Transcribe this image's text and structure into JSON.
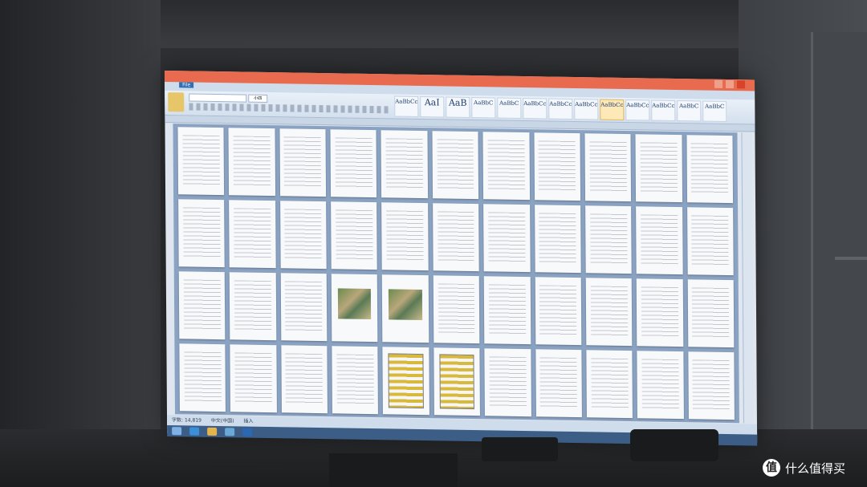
{
  "word": {
    "file_tab": "File",
    "font_size": "小四",
    "styles": [
      {
        "sample": "AaBbCc",
        "name": ""
      },
      {
        "sample": "AaI",
        "name": ""
      },
      {
        "sample": "AaB",
        "name": ""
      },
      {
        "sample": "AaBbC",
        "name": ""
      },
      {
        "sample": "AaBbC",
        "name": ""
      },
      {
        "sample": "AaBbCc",
        "name": ""
      },
      {
        "sample": "AaBbCc",
        "name": ""
      },
      {
        "sample": "AaBbCcI",
        "name": ""
      },
      {
        "sample": "AaBbCcDc",
        "name": ""
      },
      {
        "sample": "AaBbCcDd",
        "name": ""
      },
      {
        "sample": "AaBbCcDc",
        "name": ""
      },
      {
        "sample": "AaBbC",
        "name": ""
      },
      {
        "sample": "AaBbC",
        "name": ""
      }
    ],
    "status": {
      "words": "字数: 14,819",
      "lang": "中文(中国)",
      "mode": "插入"
    }
  },
  "watermark": {
    "logo": "值",
    "text": "什么值得买"
  }
}
